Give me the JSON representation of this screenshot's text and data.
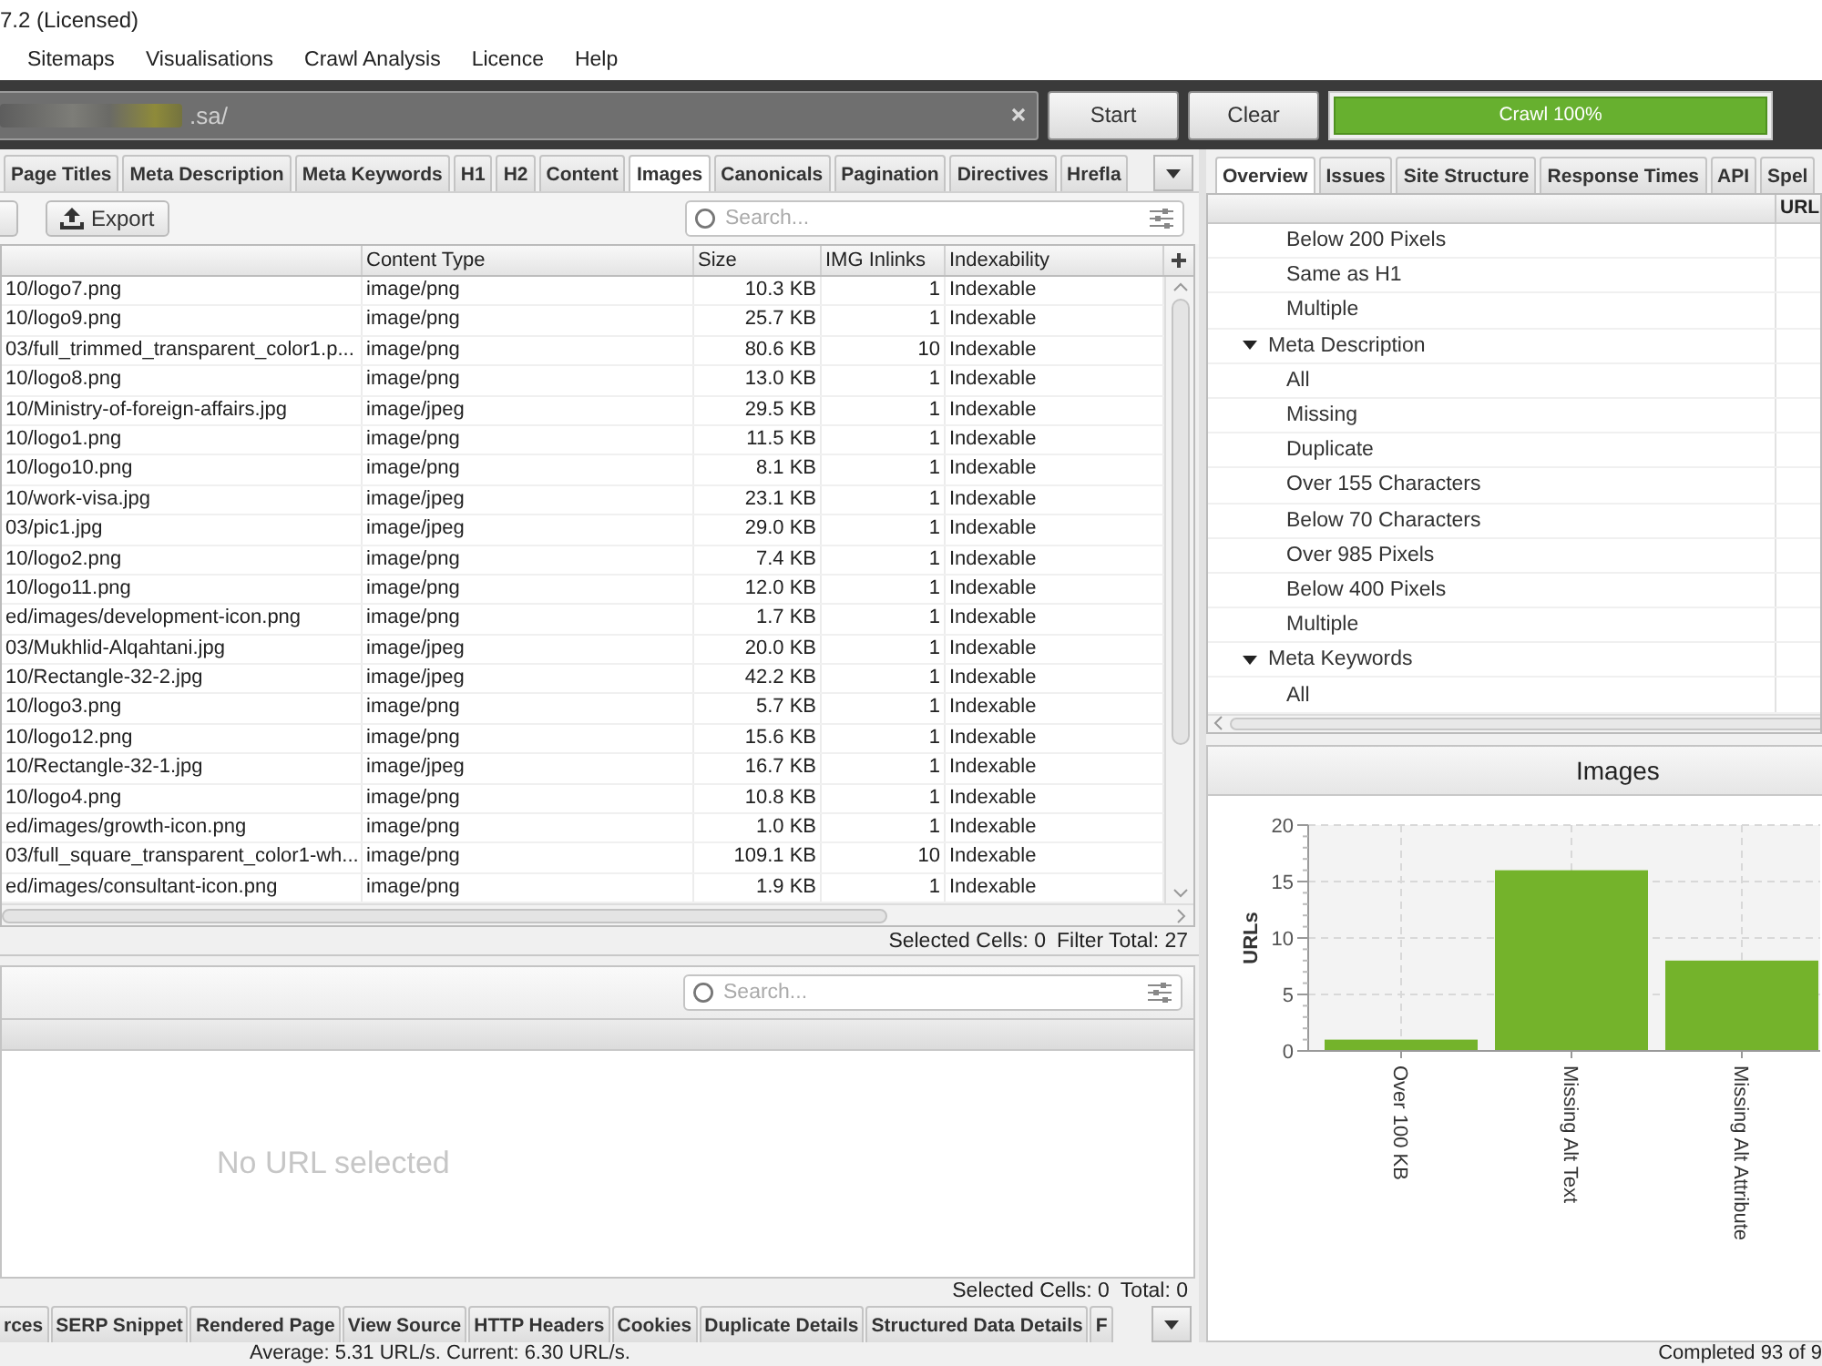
{
  "window": {
    "title": "7.2 (Licensed)"
  },
  "menu": [
    {
      "label": "Sitemaps"
    },
    {
      "label": "Visualisations"
    },
    {
      "label": "Crawl Analysis"
    },
    {
      "label": "Licence"
    },
    {
      "label": "Help"
    }
  ],
  "crawl_bar": {
    "url": ".sa/",
    "buttons": [
      {
        "label": "Start"
      },
      {
        "label": "Clear"
      }
    ],
    "progress": {
      "label": "Crawl 100%",
      "level": 1
    }
  },
  "left_tabs": [
    {
      "label": "Page Titles",
      "selected": false
    },
    {
      "label": "Meta Description",
      "selected": false
    },
    {
      "label": "Meta Keywords",
      "selected": false
    },
    {
      "label": "H1",
      "selected": false
    },
    {
      "label": "H2",
      "selected": false
    },
    {
      "label": "Content",
      "selected": false
    },
    {
      "label": "Images",
      "selected": true
    },
    {
      "label": "Canonicals",
      "selected": false
    },
    {
      "label": "Pagination",
      "selected": false
    },
    {
      "label": "Directives",
      "selected": false
    },
    {
      "label": "Hrefla",
      "selected": false
    }
  ],
  "list_toolbar": {
    "export": "Export",
    "search": {
      "placeholder": "Search..."
    }
  },
  "table": {
    "columns": {
      "content_type": "Content Type",
      "size": "Size",
      "img_inlinks": "IMG Inlinks",
      "indexability": "Indexability"
    },
    "rows": [
      {
        "column_1": "10/logo7.png",
        "content_type": "image/png",
        "size": "10.3 KB",
        "img_inlinks": "1",
        "indexability": "Indexable"
      },
      {
        "column_1": "10/logo9.png",
        "content_type": "image/png",
        "size": "25.7 KB",
        "img_inlinks": "1",
        "indexability": "Indexable"
      },
      {
        "column_1": "03/full_trimmed_transparent_color1.p...",
        "content_type": "image/png",
        "size": "80.6 KB",
        "img_inlinks": "10",
        "indexability": "Indexable"
      },
      {
        "column_1": "10/logo8.png",
        "content_type": "image/png",
        "size": "13.0 KB",
        "img_inlinks": "1",
        "indexability": "Indexable"
      },
      {
        "column_1": "10/Ministry-of-foreign-affairs.jpg",
        "content_type": "image/jpeg",
        "size": "29.5 KB",
        "img_inlinks": "1",
        "indexability": "Indexable"
      },
      {
        "column_1": "10/logo1.png",
        "content_type": "image/png",
        "size": "11.5 KB",
        "img_inlinks": "1",
        "indexability": "Indexable"
      },
      {
        "column_1": "10/logo10.png",
        "content_type": "image/png",
        "size": "8.1 KB",
        "img_inlinks": "1",
        "indexability": "Indexable"
      },
      {
        "column_1": "10/work-visa.jpg",
        "content_type": "image/jpeg",
        "size": "23.1 KB",
        "img_inlinks": "1",
        "indexability": "Indexable"
      },
      {
        "column_1": "03/pic1.jpg",
        "content_type": "image/jpeg",
        "size": "29.0 KB",
        "img_inlinks": "1",
        "indexability": "Indexable"
      },
      {
        "column_1": "10/logo2.png",
        "content_type": "image/png",
        "size": "7.4 KB",
        "img_inlinks": "1",
        "indexability": "Indexable"
      },
      {
        "column_1": "10/logo11.png",
        "content_type": "image/png",
        "size": "12.0 KB",
        "img_inlinks": "1",
        "indexability": "Indexable"
      },
      {
        "column_1": "ed/images/development-icon.png",
        "content_type": "image/png",
        "size": "1.7 KB",
        "img_inlinks": "1",
        "indexability": "Indexable"
      },
      {
        "column_1": "03/Mukhlid-Alqahtani.jpg",
        "content_type": "image/jpeg",
        "size": "20.0 KB",
        "img_inlinks": "1",
        "indexability": "Indexable"
      },
      {
        "column_1": "10/Rectangle-32-2.jpg",
        "content_type": "image/jpeg",
        "size": "42.2 KB",
        "img_inlinks": "1",
        "indexability": "Indexable"
      },
      {
        "column_1": "10/logo3.png",
        "content_type": "image/png",
        "size": "5.7 KB",
        "img_inlinks": "1",
        "indexability": "Indexable"
      },
      {
        "column_1": "10/logo12.png",
        "content_type": "image/png",
        "size": "15.6 KB",
        "img_inlinks": "1",
        "indexability": "Indexable"
      },
      {
        "column_1": "10/Rectangle-32-1.jpg",
        "content_type": "image/jpeg",
        "size": "16.7 KB",
        "img_inlinks": "1",
        "indexability": "Indexable"
      },
      {
        "column_1": "10/logo4.png",
        "content_type": "image/png",
        "size": "10.8 KB",
        "img_inlinks": "1",
        "indexability": "Indexable"
      },
      {
        "column_1": "ed/images/growth-icon.png",
        "content_type": "image/png",
        "size": "1.0 KB",
        "img_inlinks": "1",
        "indexability": "Indexable"
      },
      {
        "column_1": "03/full_square_transparent_color1-wh...",
        "content_type": "image/png",
        "size": "109.1 KB",
        "img_inlinks": "10",
        "indexability": "Indexable"
      },
      {
        "column_1": "ed/images/consultant-icon.png",
        "content_type": "image/png",
        "size": "1.9 KB",
        "img_inlinks": "1",
        "indexability": "Indexable"
      }
    ]
  },
  "table_status": {
    "selected": "Selected Cells: 0",
    "total": "Filter Total: 27"
  },
  "details": {
    "search": {
      "placeholder": "Search..."
    },
    "message": "No URL selected",
    "selected": "Selected Cells: 0",
    "total": "Total: 0"
  },
  "detail_tabs": [
    {
      "label": "rces",
      "selected": false
    },
    {
      "label": "SERP Snippet",
      "selected": false
    },
    {
      "label": "Rendered Page",
      "selected": false
    },
    {
      "label": "View Source",
      "selected": false
    },
    {
      "label": "HTTP Headers",
      "selected": false
    },
    {
      "label": "Cookies",
      "selected": false
    },
    {
      "label": "Duplicate Details",
      "selected": false
    },
    {
      "label": "Structured Data Details",
      "selected": false
    },
    {
      "label": "F",
      "selected": false
    }
  ],
  "right_tabs": [
    {
      "label": "Overview",
      "selected": true
    },
    {
      "label": "Issues",
      "selected": false
    },
    {
      "label": "Site Structure",
      "selected": false
    },
    {
      "label": "Response Times",
      "selected": false
    },
    {
      "label": "API",
      "selected": false
    },
    {
      "label": "Spel",
      "selected": false
    }
  ],
  "overview": {
    "column_2": "URL",
    "tree": [
      {
        "children": [
          {
            "label": "Below 200 Pixels"
          },
          {
            "label": "Same as H1"
          },
          {
            "label": "Multiple"
          }
        ]
      },
      {
        "label": "Meta Description",
        "expanded": true,
        "children": [
          {
            "label": "All"
          },
          {
            "label": "Missing"
          },
          {
            "label": "Duplicate"
          },
          {
            "label": "Over 155 Characters"
          },
          {
            "label": "Below 70 Characters"
          },
          {
            "label": "Over 985 Pixels"
          },
          {
            "label": "Below 400 Pixels"
          },
          {
            "label": "Multiple"
          }
        ]
      },
      {
        "label": "Meta Keywords",
        "expanded": true,
        "children": [
          {
            "label": "All"
          }
        ]
      }
    ]
  },
  "chart_panel": {
    "chart_data": [
      {
        "type": "bar",
        "title": "Images",
        "ylabel": "URLs",
        "categories": [
          "Over 100 KB",
          "Missing Alt Text",
          "Missing Alt Attribute"
        ],
        "values": [
          1,
          16,
          8
        ],
        "color": "#74b32b",
        "ylim": [
          0,
          20
        ],
        "yticks": [
          0,
          5,
          10,
          15,
          20
        ],
        "grid": true
      }
    ]
  },
  "status_bar": {
    "speed": "Average: 5.31 URL/s. Current: 6.30 URL/s.",
    "progress": "Completed 93 of 9"
  }
}
